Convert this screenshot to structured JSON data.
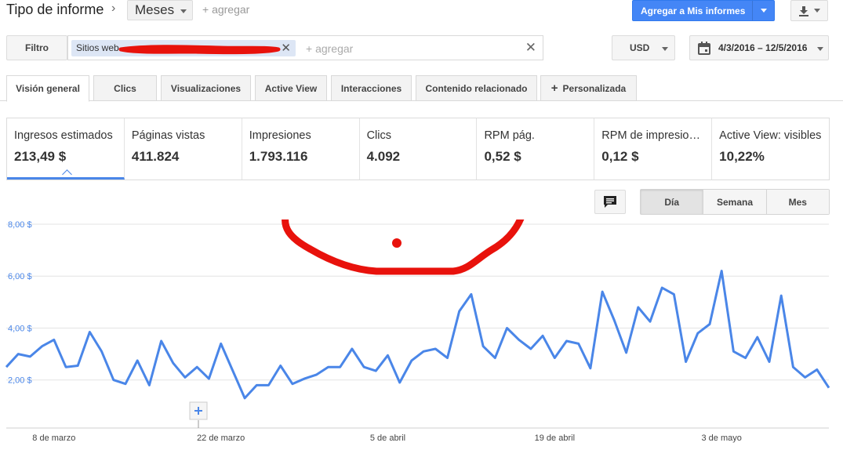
{
  "header": {
    "report_type": "Tipo de informe",
    "period": "Meses",
    "add_label": "+ agregar",
    "save_button": "Agregar a Mis informes"
  },
  "filter": {
    "button": "Filtro",
    "chip_text": "Sitios web",
    "add_placeholder": "+ agregar",
    "currency": "USD",
    "date_range": "4/3/2016 – 12/5/2016"
  },
  "tabs": [
    {
      "label": "Visión general",
      "active": true
    },
    {
      "label": "Clics",
      "active": false
    },
    {
      "label": "Visualizaciones",
      "active": false
    },
    {
      "label": "Active View",
      "active": false
    },
    {
      "label": "Interacciones",
      "active": false
    },
    {
      "label": "Contenido relacionado",
      "active": false
    },
    {
      "label": "Personalizada",
      "active": false
    }
  ],
  "metrics": [
    {
      "label": "Ingresos estimados",
      "value": "213,49 $"
    },
    {
      "label": "Páginas vistas",
      "value": "411.824"
    },
    {
      "label": "Impresiones",
      "value": "1.793.116"
    },
    {
      "label": "Clics",
      "value": "4.092"
    },
    {
      "label": "RPM pág.",
      "value": "0,52 $"
    },
    {
      "label": "RPM de impresiones",
      "value": "0,12 $"
    },
    {
      "label": "Active View: visibles",
      "value": "10,22%"
    }
  ],
  "granularity": [
    "Día",
    "Semana",
    "Mes"
  ],
  "granularity_active": "Día",
  "colors": {
    "accent": "#4a86e8",
    "primary_button": "#4486f6",
    "annotation": "#e8120c"
  },
  "chart_data": {
    "type": "line",
    "y_tick_labels": [
      "8,00 $",
      "6,00 $",
      "4,00 $",
      "2,00 $"
    ],
    "y_ticks": [
      8,
      6,
      4,
      2
    ],
    "ylim": [
      0.15,
      8.0
    ],
    "x_tick_labels": [
      "8 de marzo",
      "22 de marzo",
      "5 de abril",
      "19 de abril",
      "3 de mayo"
    ],
    "x_tick_days": [
      "2016-03-08",
      "2016-03-22",
      "2016-04-05",
      "2016-04-19",
      "2016-05-03"
    ],
    "xlim": [
      "2016-03-04",
      "2016-05-12"
    ],
    "grid": true,
    "series": [
      {
        "x_start": "2016-03-04",
        "x_step": "1 day",
        "values": [
          2.5,
          3.0,
          2.9,
          3.3,
          3.55,
          2.5,
          2.55,
          3.85,
          3.1,
          2.0,
          1.85,
          2.75,
          1.8,
          3.5,
          2.65,
          2.1,
          2.5,
          2.05,
          3.4,
          2.35,
          1.3,
          1.8,
          1.8,
          2.55,
          1.85,
          2.05,
          2.2,
          2.5,
          2.5,
          3.2,
          2.5,
          2.35,
          2.95,
          1.9,
          2.75,
          3.1,
          3.2,
          2.85,
          4.65,
          5.3,
          3.3,
          2.85,
          4.0,
          3.55,
          3.2,
          3.7,
          2.85,
          3.5,
          3.4,
          2.45,
          5.4,
          4.3,
          3.05,
          4.8,
          4.25,
          5.55,
          5.3,
          2.7,
          3.8,
          4.15,
          6.2,
          3.1,
          2.85,
          3.65,
          2.7,
          5.25,
          2.5,
          2.1,
          2.4,
          1.7
        ]
      }
    ]
  }
}
